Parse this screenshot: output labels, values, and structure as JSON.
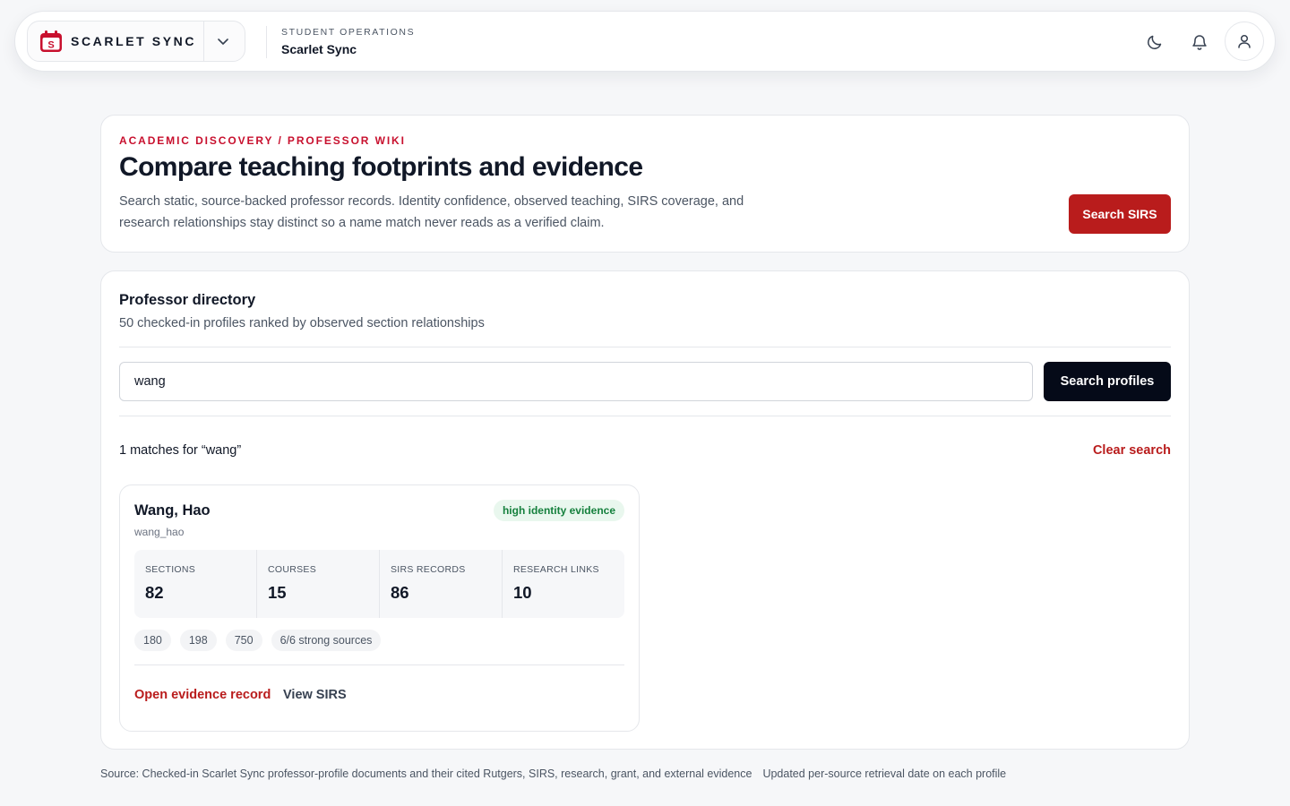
{
  "app": {
    "brand_name": "SCARLET SYNC",
    "context_eyebrow": "STUDENT OPERATIONS",
    "context_title": "Scarlet Sync",
    "brand_color": "#c8102e",
    "icons": [
      "calendar-logo-icon",
      "chevron-down-icon",
      "moon-icon",
      "bell-icon",
      "user-icon"
    ]
  },
  "hero": {
    "eyebrow": "ACADEMIC DISCOVERY / PROFESSOR WIKI",
    "title": "Compare teaching footprints and evidence",
    "description": "Search static, source-backed professor records. Identity confidence, observed teaching, SIRS coverage, and research relationships stay distinct so a name match never reads as a verified claim.",
    "button_label": "Search SIRS"
  },
  "directory": {
    "title": "Professor directory",
    "subtitle": "50 checked-in profiles ranked by observed section relationships",
    "search_value": "wang",
    "search_button": "Search profiles",
    "matches_text": "1 matches for “wang”",
    "clear_label": "Clear search"
  },
  "profile": {
    "name": "Wang, Hao",
    "slug": "wang_hao",
    "badge": "high identity evidence",
    "stats": [
      {
        "label": "SECTIONS",
        "value": "82"
      },
      {
        "label": "COURSES",
        "value": "15"
      },
      {
        "label": "SIRS RECORDS",
        "value": "86"
      },
      {
        "label": "RESEARCH LINKS",
        "value": "10"
      }
    ],
    "chips": [
      "180",
      "198",
      "750",
      "6/6 strong sources"
    ],
    "link_evidence": "Open evidence record",
    "link_sirs": "View SIRS"
  },
  "footer": {
    "source": "Source: Checked-in Scarlet Sync professor-profile documents and their cited Rutgers, SIRS, research, grant, and external evidence",
    "updated": "Updated per-source retrieval date on each profile"
  }
}
